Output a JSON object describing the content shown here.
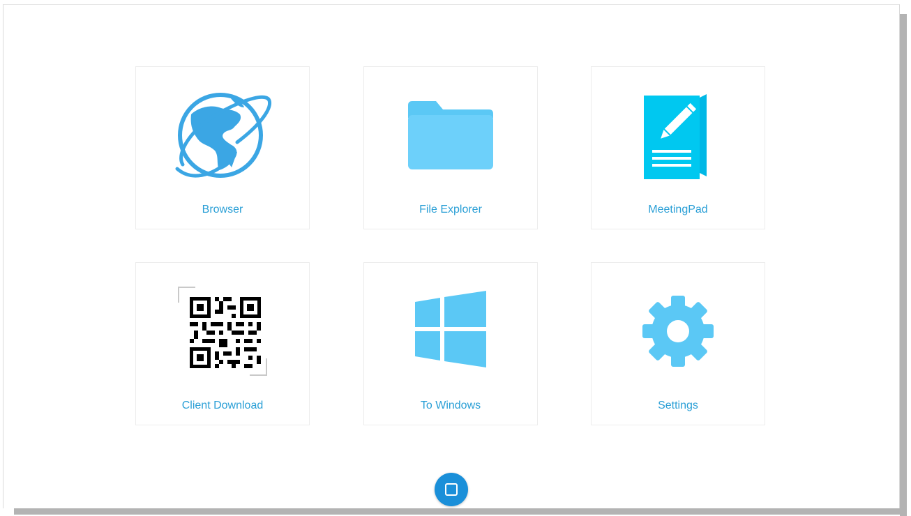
{
  "tiles": [
    {
      "label": "Browser",
      "icon": "globe-icon"
    },
    {
      "label": "File Explorer",
      "icon": "folder-icon"
    },
    {
      "label": "MeetingPad",
      "icon": "notepad-icon"
    },
    {
      "label": "Client Download",
      "icon": "qr-code-icon"
    },
    {
      "label": "To Windows",
      "icon": "windows-icon"
    },
    {
      "label": "Settings",
      "icon": "gear-icon"
    }
  ],
  "home_button": {
    "icon": "square-icon"
  },
  "colors": {
    "accent": "#2a9fd6",
    "icon_blue": "#5bc8f5",
    "home": "#1a8fd9",
    "notepad": "#00c8f0"
  }
}
